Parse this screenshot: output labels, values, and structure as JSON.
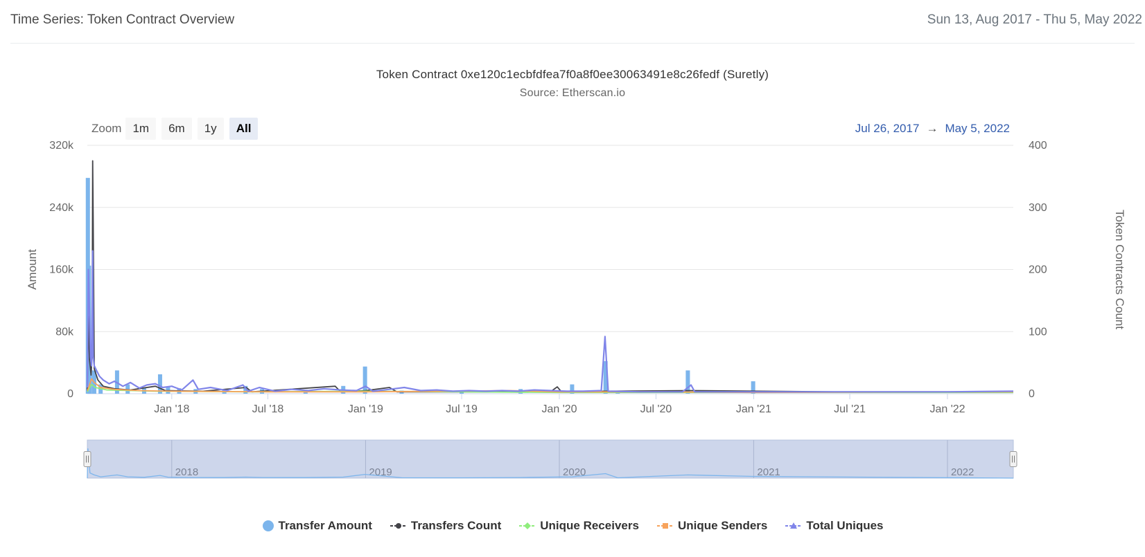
{
  "header": {
    "title": "Time Series: Token Contract Overview",
    "date_range": "Sun 13, Aug 2017 - Thu 5, May 2022"
  },
  "zoom": {
    "label": "Zoom",
    "buttons": [
      "1m",
      "6m",
      "1y",
      "All"
    ],
    "active": "All"
  },
  "range_display": {
    "from": "Jul 26, 2017",
    "arrow": "→",
    "to": "May 5, 2022"
  },
  "colors": {
    "transfer_amount": "#7cb5ec",
    "transfers_count": "#434348",
    "unique_receivers": "#90ed7d",
    "unique_senders": "#f7a35c",
    "total_uniques": "#8085e9",
    "navigator_fill": "#cdd6eb",
    "navigator_series": "#7cb5ec"
  },
  "chart_data": {
    "type": "line",
    "title": "Token Contract 0xe120c1ecbfdfea7f0a8f0ee30063491e8c26fedf (Suretly)",
    "subtitle": "Source: Etherscan.io",
    "x_range": [
      "2017-07-26",
      "2022-05-05"
    ],
    "x_ticks": [
      {
        "date": "2018-01-01",
        "label": "Jan '18"
      },
      {
        "date": "2018-07-01",
        "label": "Jul '18"
      },
      {
        "date": "2019-01-01",
        "label": "Jan '19"
      },
      {
        "date": "2019-07-01",
        "label": "Jul '19"
      },
      {
        "date": "2020-01-01",
        "label": "Jan '20"
      },
      {
        "date": "2020-07-01",
        "label": "Jul '20"
      },
      {
        "date": "2021-01-01",
        "label": "Jan '21"
      },
      {
        "date": "2021-07-01",
        "label": "Jul '21"
      },
      {
        "date": "2022-01-01",
        "label": "Jan '22"
      }
    ],
    "navigator_ticks": [
      {
        "date": "2018-01-01",
        "label": "2018"
      },
      {
        "date": "2019-01-01",
        "label": "2019"
      },
      {
        "date": "2020-01-01",
        "label": "2020"
      },
      {
        "date": "2021-01-01",
        "label": "2021"
      },
      {
        "date": "2022-01-01",
        "label": "2022"
      }
    ],
    "y_left": {
      "label": "Amount",
      "ylim": [
        0,
        320000
      ],
      "ticks": [
        0,
        80000,
        160000,
        240000,
        320000
      ],
      "tick_labels": [
        "0",
        "80k",
        "160k",
        "240k",
        "320k"
      ]
    },
    "y_right": {
      "label": "Token Contracts Count",
      "ylim": [
        0,
        400
      ],
      "ticks": [
        0,
        100,
        200,
        300,
        400
      ],
      "tick_labels": [
        "0",
        "100",
        "200",
        "300",
        "400"
      ]
    },
    "grid": true,
    "legend_position": "bottom",
    "series": [
      {
        "name": "Transfer Amount",
        "type": "column",
        "axis": "left",
        "color": "#7cb5ec",
        "points": [
          [
            "2017-07-27",
            278000
          ],
          [
            "2017-07-29",
            165000
          ],
          [
            "2017-07-31",
            48000
          ],
          [
            "2017-08-08",
            30000
          ],
          [
            "2017-08-20",
            12000
          ],
          [
            "2017-09-20",
            30000
          ],
          [
            "2017-10-10",
            12000
          ],
          [
            "2017-11-10",
            8000
          ],
          [
            "2017-12-10",
            25000
          ],
          [
            "2017-12-25",
            9000
          ],
          [
            "2018-01-15",
            7000
          ],
          [
            "2018-02-15",
            6000
          ],
          [
            "2018-04-10",
            5000
          ],
          [
            "2018-05-20",
            10000
          ],
          [
            "2018-06-20",
            6000
          ],
          [
            "2018-09-10",
            5000
          ],
          [
            "2018-11-20",
            10000
          ],
          [
            "2018-12-31",
            35000
          ],
          [
            "2019-03-10",
            4000
          ],
          [
            "2019-07-01",
            3000
          ],
          [
            "2019-10-20",
            6000
          ],
          [
            "2020-01-25",
            12000
          ],
          [
            "2020-03-28",
            42000
          ],
          [
            "2020-04-20",
            3000
          ],
          [
            "2020-08-30",
            30000
          ],
          [
            "2020-12-31",
            16000
          ]
        ]
      },
      {
        "name": "Transfers Count",
        "type": "line",
        "axis": "right",
        "color": "#434348",
        "points": [
          [
            "2017-07-26",
            5
          ],
          [
            "2017-07-28",
            125
          ],
          [
            "2017-07-30",
            55
          ],
          [
            "2017-08-02",
            30
          ],
          [
            "2017-08-04",
            68
          ],
          [
            "2017-08-05",
            375
          ],
          [
            "2017-08-06",
            285
          ],
          [
            "2017-08-08",
            40
          ],
          [
            "2017-08-15",
            22
          ],
          [
            "2017-08-25",
            12
          ],
          [
            "2017-09-15",
            8
          ],
          [
            "2017-10-15",
            6
          ],
          [
            "2017-12-01",
            12
          ],
          [
            "2017-12-20",
            5
          ],
          [
            "2018-03-01",
            4
          ],
          [
            "2018-05-21",
            10
          ],
          [
            "2018-06-01",
            3
          ],
          [
            "2018-11-05",
            12
          ],
          [
            "2018-11-15",
            3
          ],
          [
            "2019-01-01",
            5
          ],
          [
            "2019-02-15",
            10
          ],
          [
            "2019-03-01",
            3
          ],
          [
            "2019-12-15",
            3
          ],
          [
            "2019-12-28",
            11
          ],
          [
            "2020-01-05",
            3
          ],
          [
            "2020-03-28",
            4
          ],
          [
            "2020-09-05",
            5
          ],
          [
            "2021-06-01",
            3
          ],
          [
            "2022-05-05",
            3
          ]
        ]
      },
      {
        "name": "Unique Receivers",
        "type": "line",
        "axis": "right",
        "color": "#90ed7d",
        "points": [
          [
            "2017-07-26",
            3
          ],
          [
            "2017-08-03",
            15
          ],
          [
            "2017-08-10",
            10
          ],
          [
            "2017-09-01",
            6
          ],
          [
            "2017-12-01",
            4
          ],
          [
            "2018-06-01",
            3
          ],
          [
            "2019-01-01",
            4
          ],
          [
            "2020-01-01",
            2
          ],
          [
            "2021-01-01",
            2
          ],
          [
            "2022-05-05",
            2
          ]
        ]
      },
      {
        "name": "Unique Senders",
        "type": "line",
        "axis": "right",
        "color": "#f7a35c",
        "points": [
          [
            "2017-07-26",
            5
          ],
          [
            "2017-07-30",
            14
          ],
          [
            "2017-08-03",
            24
          ],
          [
            "2017-08-08",
            18
          ],
          [
            "2017-08-20",
            10
          ],
          [
            "2017-09-15",
            7
          ],
          [
            "2017-11-01",
            5
          ],
          [
            "2018-01-01",
            4
          ],
          [
            "2018-07-01",
            3
          ],
          [
            "2019-01-01",
            3
          ],
          [
            "2019-06-01",
            4
          ],
          [
            "2019-10-01",
            5
          ],
          [
            "2020-01-01",
            3
          ],
          [
            "2020-07-01",
            3
          ],
          [
            "2021-01-01",
            2
          ],
          [
            "2022-05-05",
            3
          ]
        ]
      },
      {
        "name": "Total Uniques",
        "type": "line",
        "axis": "right",
        "color": "#8085e9",
        "points": [
          [
            "2017-07-26",
            10
          ],
          [
            "2017-07-28",
            200
          ],
          [
            "2017-07-30",
            130
          ],
          [
            "2017-08-01",
            60
          ],
          [
            "2017-08-03",
            45
          ],
          [
            "2017-08-05",
            230
          ],
          [
            "2017-08-06",
            60
          ],
          [
            "2017-08-08",
            45
          ],
          [
            "2017-08-12",
            38
          ],
          [
            "2017-08-18",
            28
          ],
          [
            "2017-08-25",
            22
          ],
          [
            "2017-09-05",
            16
          ],
          [
            "2017-09-15",
            20
          ],
          [
            "2017-10-01",
            12
          ],
          [
            "2017-10-15",
            18
          ],
          [
            "2017-11-01",
            9
          ],
          [
            "2017-11-15",
            14
          ],
          [
            "2017-12-01",
            16
          ],
          [
            "2017-12-15",
            10
          ],
          [
            "2018-01-01",
            12
          ],
          [
            "2018-01-20",
            6
          ],
          [
            "2018-02-10",
            22
          ],
          [
            "2018-02-20",
            7
          ],
          [
            "2018-03-15",
            10
          ],
          [
            "2018-04-15",
            5
          ],
          [
            "2018-05-15",
            14
          ],
          [
            "2018-05-25",
            4
          ],
          [
            "2018-06-15",
            10
          ],
          [
            "2018-07-15",
            4
          ],
          [
            "2018-08-15",
            7
          ],
          [
            "2018-09-15",
            5
          ],
          [
            "2018-10-15",
            8
          ],
          [
            "2018-11-15",
            6
          ],
          [
            "2018-12-15",
            5
          ],
          [
            "2019-01-01",
            12
          ],
          [
            "2019-01-15",
            4
          ],
          [
            "2019-02-15",
            7
          ],
          [
            "2019-03-15",
            10
          ],
          [
            "2019-04-15",
            5
          ],
          [
            "2019-05-15",
            6
          ],
          [
            "2019-06-15",
            4
          ],
          [
            "2019-07-15",
            5
          ],
          [
            "2019-08-15",
            4
          ],
          [
            "2019-09-15",
            5
          ],
          [
            "2019-10-15",
            4
          ],
          [
            "2019-11-15",
            6
          ],
          [
            "2019-12-15",
            5
          ],
          [
            "2020-01-15",
            4
          ],
          [
            "2020-02-15",
            4
          ],
          [
            "2020-03-20",
            5
          ],
          [
            "2020-03-27",
            92
          ],
          [
            "2020-04-02",
            4
          ],
          [
            "2020-06-01",
            3
          ],
          [
            "2020-08-20",
            3
          ],
          [
            "2020-09-05",
            14
          ],
          [
            "2020-09-12",
            3
          ],
          [
            "2021-01-01",
            3
          ],
          [
            "2021-07-01",
            3
          ],
          [
            "2022-01-01",
            3
          ],
          [
            "2022-05-05",
            4
          ]
        ]
      }
    ]
  }
}
